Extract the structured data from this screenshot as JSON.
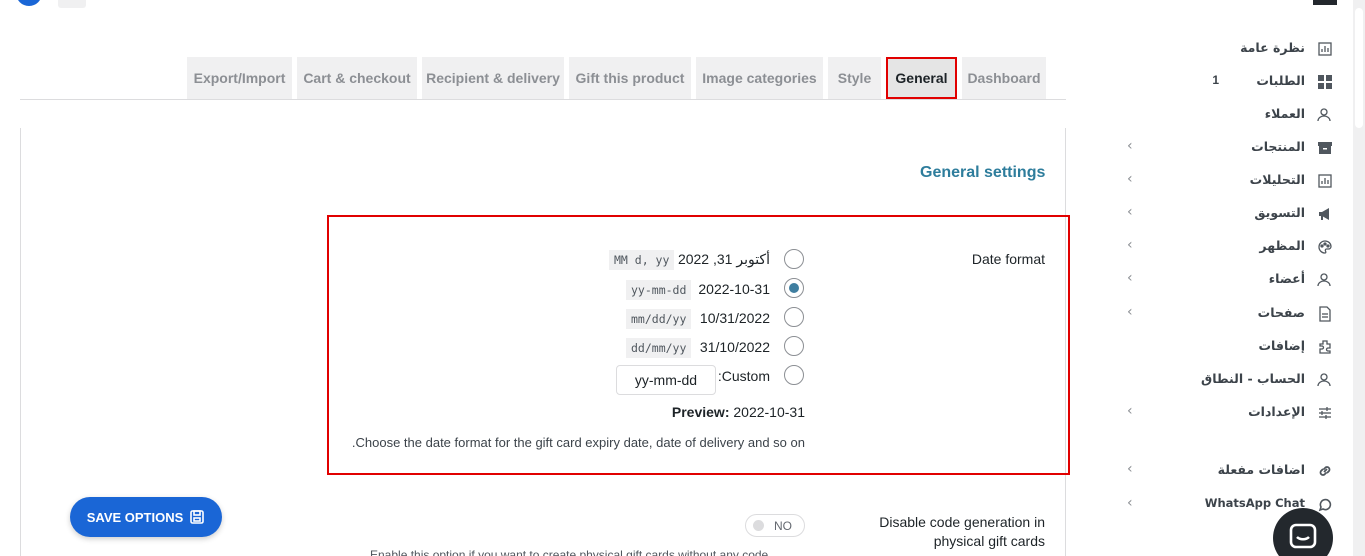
{
  "tabs": [
    {
      "label": "Export/Import"
    },
    {
      "label": "Cart & checkout"
    },
    {
      "label": "Recipient & delivery"
    },
    {
      "label": "Gift this product"
    },
    {
      "label": "Image categories"
    },
    {
      "label": "Style"
    },
    {
      "label": "General"
    },
    {
      "label": "Dashboard"
    }
  ],
  "active_tab": "General",
  "section_title": "General settings",
  "date_format": {
    "label": "Date format",
    "options": [
      {
        "text": "أكتوبر 31, 2022",
        "code": "MM d, yy",
        "checked": false
      },
      {
        "text": "2022-10-31",
        "code": "yy-mm-dd",
        "checked": true
      },
      {
        "text": "10/31/2022",
        "code": "mm/dd/yy",
        "checked": false
      },
      {
        "text": "31/10/2022",
        "code": "dd/mm/yy",
        "checked": false
      }
    ],
    "custom_label": ":Custom",
    "custom_value": "yy-mm-dd",
    "preview_label": "Preview:",
    "preview_value": "2022-10-31",
    "description": ".Choose the date format for the gift card expiry date, date of delivery and so on"
  },
  "disable_code": {
    "label_line1": "Disable code generation in",
    "label_line2": "physical gift cards",
    "toggle_text": "NO",
    "description_partial": "Enable this option if you want to create physical gift cards without any code"
  },
  "save_button": {
    "label": "SAVE OPTIONS"
  },
  "sidebar": {
    "items": [
      {
        "label": "نظرة عامة",
        "icon": "overview-icon",
        "chevron": false
      },
      {
        "label": "الطلبات",
        "icon": "orders-grid-icon",
        "chevron": false,
        "badge": "1"
      },
      {
        "label": "العملاء",
        "icon": "customers-icon",
        "chevron": false
      },
      {
        "label": "المنتجات",
        "icon": "products-box-icon",
        "chevron": true
      },
      {
        "label": "التحليلات",
        "icon": "analytics-icon",
        "chevron": true
      },
      {
        "label": "التسويق",
        "icon": "marketing-megaphone-icon",
        "chevron": true
      },
      {
        "label": "المظهر",
        "icon": "appearance-palette-icon",
        "chevron": true
      },
      {
        "label": "أعضاء",
        "icon": "members-icon",
        "chevron": true
      },
      {
        "label": "صفحات",
        "icon": "pages-icon",
        "chevron": true
      },
      {
        "label": "إضافات",
        "icon": "plugins-icon",
        "chevron": false
      },
      {
        "label": "الحساب - النطاق",
        "icon": "account-icon",
        "chevron": false
      },
      {
        "label": "الإعدادات",
        "icon": "settings-sliders-icon",
        "chevron": true
      },
      {
        "label": "اضافات مفعلة",
        "icon": "link-icon",
        "chevron": true
      },
      {
        "label": "WhatsApp Chat",
        "icon": "whatsapp-icon",
        "chevron": true
      }
    ]
  },
  "colors": {
    "accent": "#1a66d6",
    "section_title": "#2e7d9c",
    "highlight": "#e10000",
    "radio_checked": "#3f7ea0"
  }
}
